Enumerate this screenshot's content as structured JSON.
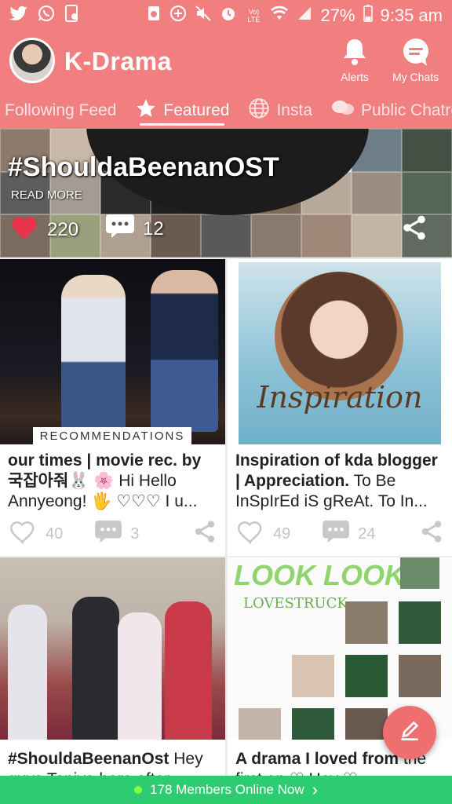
{
  "statusbar": {
    "battery_pct": "27%",
    "time": "9:35 am",
    "network": "Vo) LTE"
  },
  "header": {
    "title": "K-Drama",
    "alerts_label": "Alerts",
    "chats_label": "My Chats"
  },
  "tabs": [
    {
      "label": "Following Feed",
      "icon": "none"
    },
    {
      "label": "Featured",
      "icon": "star-icon"
    },
    {
      "label": "Insta",
      "icon": "globe-icon"
    },
    {
      "label": "Public Chatro",
      "icon": "chat-bubbles-icon"
    }
  ],
  "banner": {
    "title": "#ShouldaBeenanOST",
    "read_more": "READ MORE",
    "likes": "220",
    "comments": "12"
  },
  "cards": [
    {
      "image_caption": "RECOMMENDATIONS",
      "title": "our times | movie rec. by 국잡아줘🐰 🌸",
      "excerpt": " Hi Hello Annyeong! 🖐 ♡♡♡ I u...",
      "likes": "40",
      "comments": "3"
    },
    {
      "image_caption": "Inspiration",
      "title": "Inspiration of kda blogger | Appreciation.",
      "excerpt": " To Be InSpIrEd iS gReAt. To In...",
      "likes": "49",
      "comments": "24"
    },
    {
      "title": "#ShouldaBeenanOst",
      "excerpt": " Hey guys Taniya here after"
    },
    {
      "image_caption_top": "LOOK LOOK",
      "image_caption": "LOVESTRUCK",
      "title": "A drama I loved from",
      "excerpt": " the first ep ♡ Hey ♡"
    }
  ],
  "bottom_bar": {
    "label": "178 Members Online Now",
    "chevron": "›"
  },
  "colors": {
    "brand": "#f27f7f",
    "online_bar": "#2ecc71",
    "like_red": "#e8334a"
  }
}
